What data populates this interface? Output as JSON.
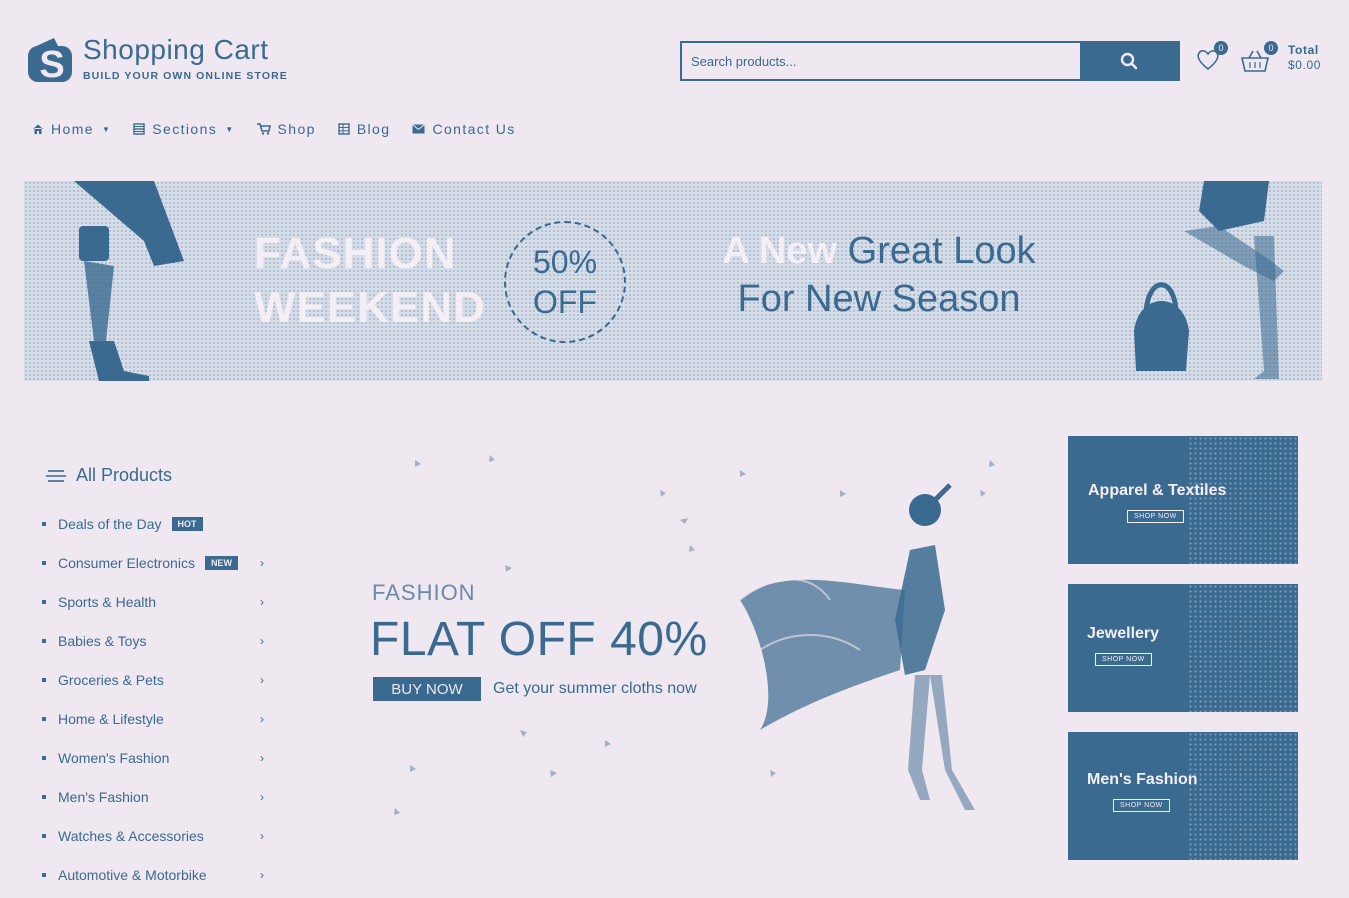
{
  "header": {
    "logo_title": "Shopping Cart",
    "logo_subtitle": "BUILD YOUR OWN ONLINE STORE",
    "logo_icon": "shopping-bag-icon"
  },
  "search": {
    "placeholder": "Search products..."
  },
  "wishlist": {
    "count": "0"
  },
  "cart": {
    "count": "0",
    "total_label": "Total",
    "total_value": "$0.00"
  },
  "nav": {
    "items": [
      {
        "label": "Home",
        "icon": "home-icon",
        "dropdown": true
      },
      {
        "label": "Sections",
        "icon": "grid-icon",
        "dropdown": true
      },
      {
        "label": "Shop",
        "icon": "cart-icon",
        "dropdown": false
      },
      {
        "label": "Blog",
        "icon": "table-icon",
        "dropdown": false
      },
      {
        "label": "Contact Us",
        "icon": "envelope-icon",
        "dropdown": false
      }
    ]
  },
  "banner": {
    "line1": "FASHION",
    "line2": "WEEKEND",
    "badge_line1": "50%",
    "badge_line2": "OFF",
    "tag_word1": "A New",
    "tag_word2": "Great Look",
    "tag_line2": "For New Season"
  },
  "categories": {
    "title": "All Products",
    "items": [
      {
        "label": "Deals of the Day",
        "badge": "HOT",
        "chevron": false
      },
      {
        "label": "Consumer Electronics",
        "badge": "NEW",
        "chevron": true
      },
      {
        "label": "Sports & Health",
        "chevron": true
      },
      {
        "label": "Babies & Toys",
        "chevron": true
      },
      {
        "label": "Groceries & Pets",
        "chevron": true
      },
      {
        "label": "Home & Lifestyle",
        "chevron": true
      },
      {
        "label": "Women's Fashion",
        "chevron": true
      },
      {
        "label": "Men's Fashion",
        "chevron": true
      },
      {
        "label": "Watches & Accessories",
        "chevron": true
      },
      {
        "label": "Automotive & Motorbike",
        "chevron": true
      }
    ],
    "chevron_glyph": "›"
  },
  "hero": {
    "kicker": "FASHION",
    "headline": "FLAT OFF 40%",
    "button": "BUY NOW",
    "subtext": "Get your summer cloths now"
  },
  "promos": [
    {
      "title": "Apparel & Textiles",
      "button": "SHOP NOW"
    },
    {
      "title": "Jewellery",
      "button": "SHOP NOW"
    },
    {
      "title": "Men's Fashion",
      "button": "SHOP NOW"
    }
  ],
  "colors": {
    "accent": "#3a6a8f",
    "background": "#efe8f0"
  }
}
